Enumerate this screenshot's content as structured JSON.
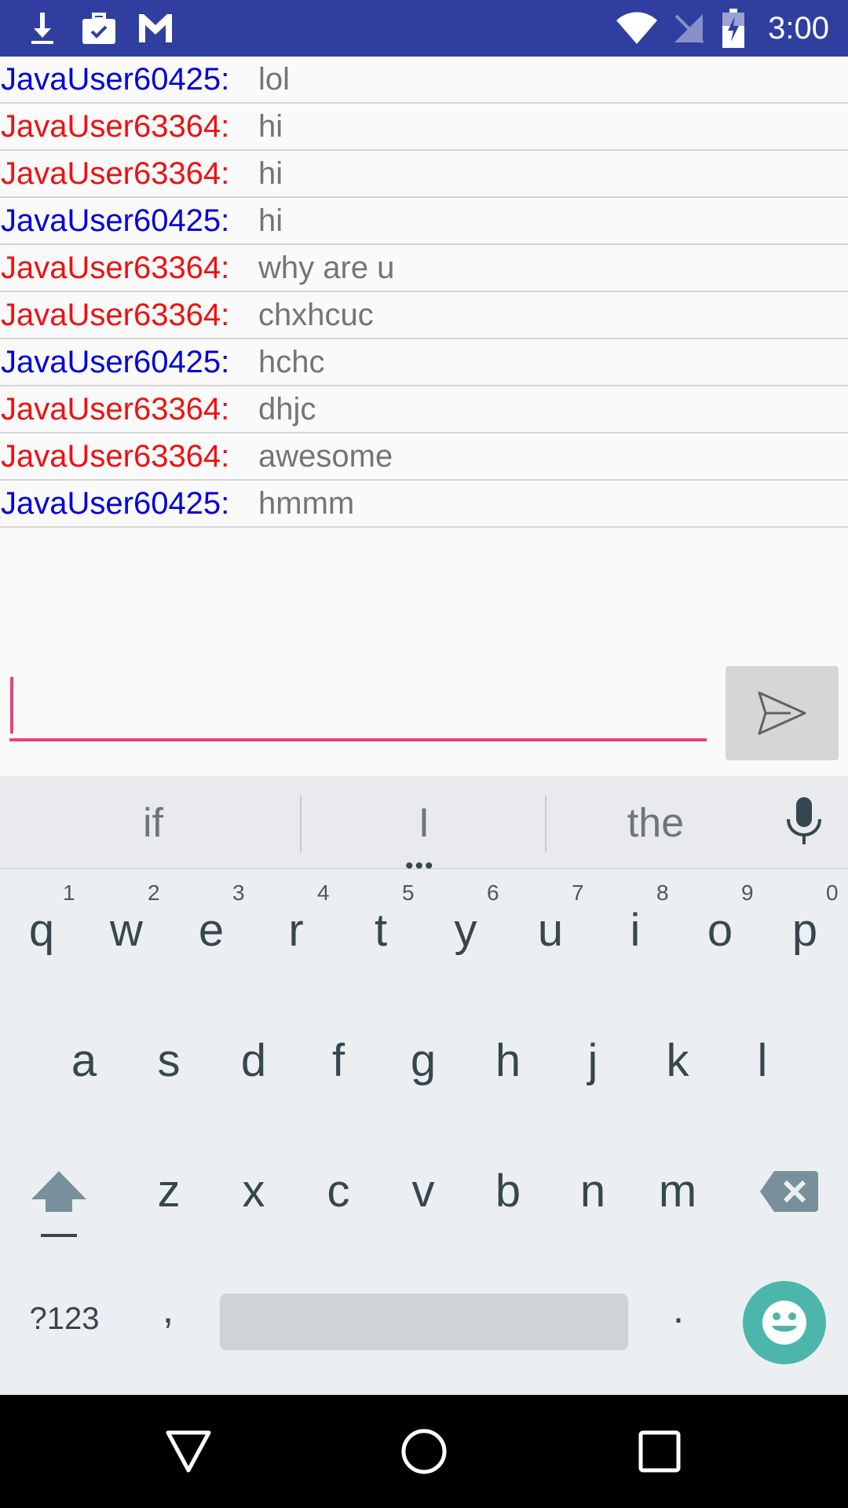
{
  "status_bar": {
    "time": "3:00",
    "left_icons": [
      "download-icon",
      "briefcase-check-icon",
      "gmail-icon"
    ],
    "right_icons": [
      "wifi-icon",
      "no-signal-icon",
      "battery-charging-icon"
    ]
  },
  "colors": {
    "status_bar": "#303f9f",
    "user_60425": "#0000dd",
    "user_63364": "#ee1111",
    "accent": "#ec407a",
    "emoji_button": "#4db6ac"
  },
  "messages": [
    {
      "user": "JavaUser60425:",
      "text": "lol",
      "color": "#0000dd"
    },
    {
      "user": "JavaUser63364:",
      "text": "hi",
      "color": "#ee1111"
    },
    {
      "user": "JavaUser63364:",
      "text": "hi",
      "color": "#ee1111"
    },
    {
      "user": "JavaUser60425:",
      "text": "hi",
      "color": "#0000dd"
    },
    {
      "user": "JavaUser63364:",
      "text": "why are u",
      "color": "#ee1111"
    },
    {
      "user": "JavaUser63364:",
      "text": "chxhcuc",
      "color": "#ee1111"
    },
    {
      "user": "JavaUser60425:",
      "text": "hchc",
      "color": "#0000dd"
    },
    {
      "user": "JavaUser63364:",
      "text": "dhjc",
      "color": "#ee1111"
    },
    {
      "user": "JavaUser63364:",
      "text": "awesome",
      "color": "#ee1111"
    },
    {
      "user": "JavaUser60425:",
      "text": "hmmm",
      "color": "#0000dd"
    }
  ],
  "composer": {
    "value": "",
    "send_icon": "send-icon"
  },
  "keyboard": {
    "suggestions": [
      "if",
      "I",
      "the"
    ],
    "row1": [
      {
        "k": "q",
        "h": "1"
      },
      {
        "k": "w",
        "h": "2"
      },
      {
        "k": "e",
        "h": "3"
      },
      {
        "k": "r",
        "h": "4"
      },
      {
        "k": "t",
        "h": "5"
      },
      {
        "k": "y",
        "h": "6"
      },
      {
        "k": "u",
        "h": "7"
      },
      {
        "k": "i",
        "h": "8"
      },
      {
        "k": "o",
        "h": "9"
      },
      {
        "k": "p",
        "h": "0"
      }
    ],
    "row2": [
      "a",
      "s",
      "d",
      "f",
      "g",
      "h",
      "j",
      "k",
      "l"
    ],
    "row3": [
      "z",
      "x",
      "c",
      "v",
      "b",
      "n",
      "m"
    ],
    "symbols_label": "?123",
    "comma": ",",
    "period": "."
  },
  "nav": {
    "icons": [
      "back-icon",
      "home-icon",
      "recents-icon"
    ]
  }
}
